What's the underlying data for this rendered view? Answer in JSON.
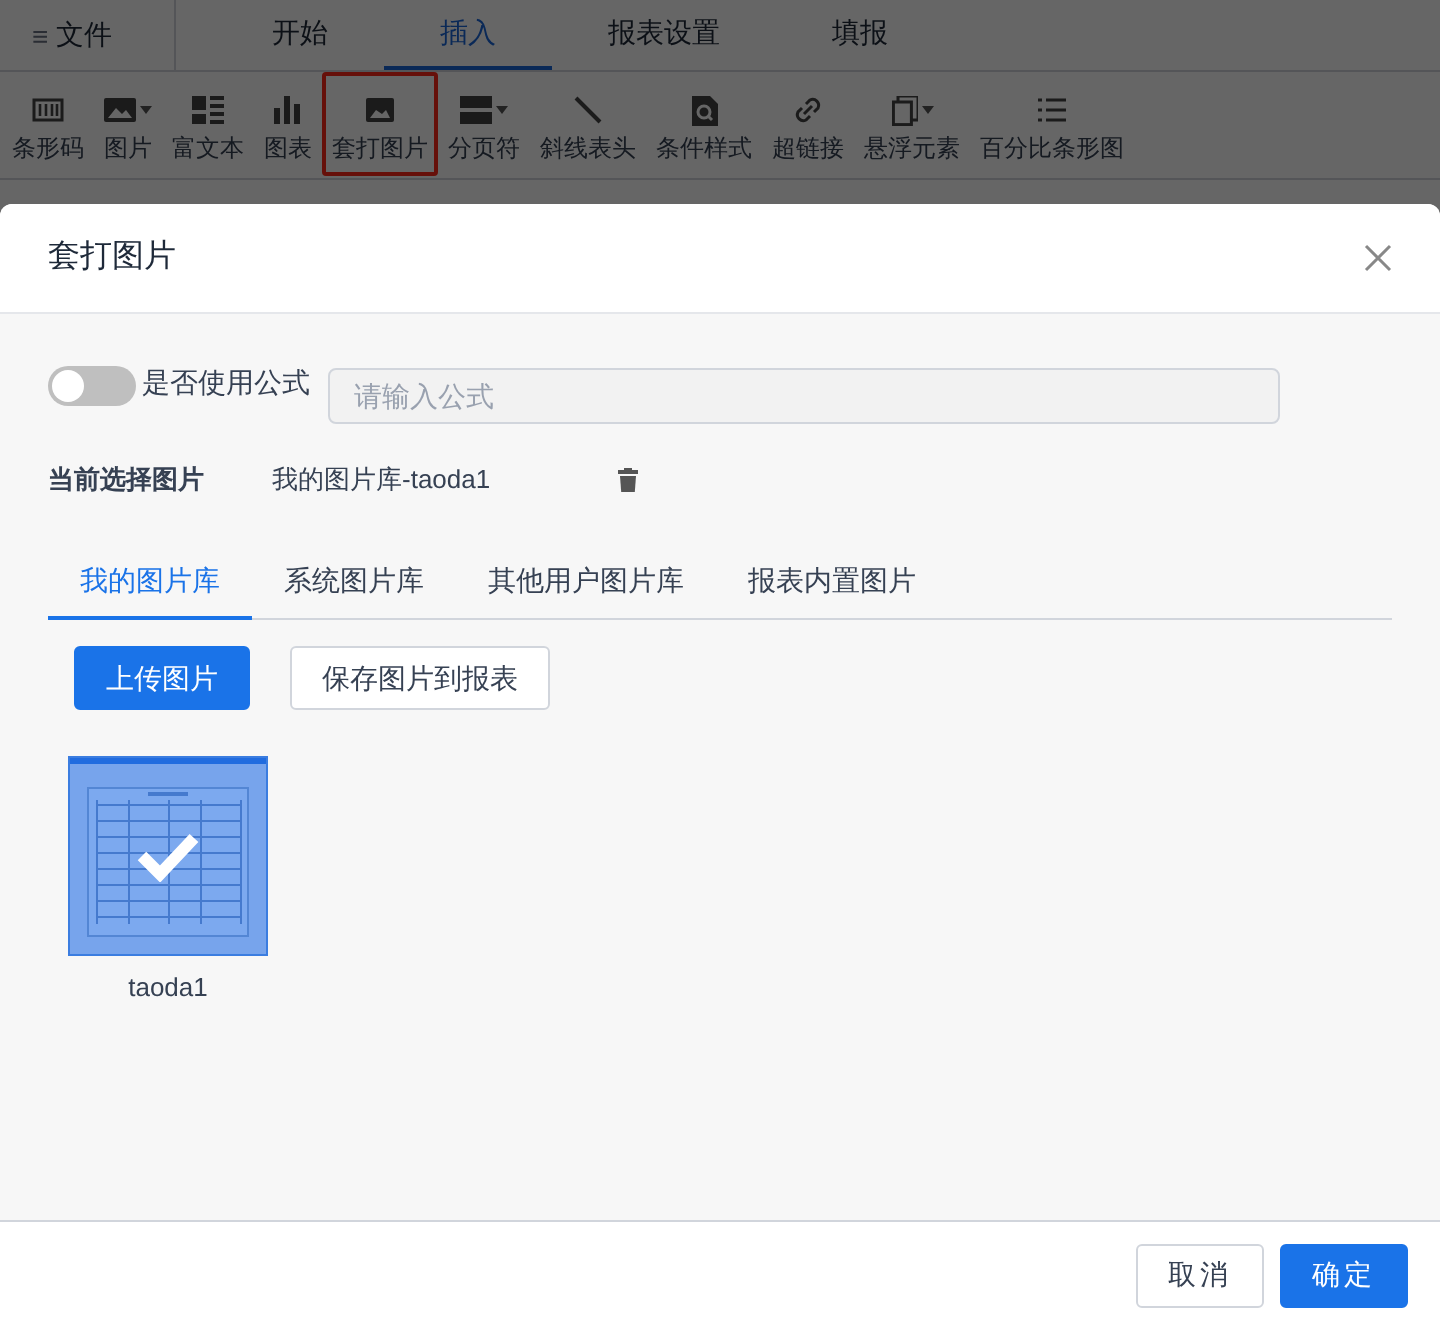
{
  "menu": {
    "icon_text": "≡",
    "label": "文件"
  },
  "tabs": [
    {
      "label": "开始",
      "selected": false
    },
    {
      "label": "插入",
      "selected": true
    },
    {
      "label": "报表设置",
      "selected": false
    },
    {
      "label": "填报",
      "selected": false
    }
  ],
  "toolbar": [
    {
      "label": "条形码",
      "dropdown": false,
      "highlighted": false
    },
    {
      "label": "图片",
      "dropdown": true,
      "highlighted": false
    },
    {
      "label": "富文本",
      "dropdown": false,
      "highlighted": false
    },
    {
      "label": "图表",
      "dropdown": false,
      "highlighted": false
    },
    {
      "label": "套打图片",
      "dropdown": false,
      "highlighted": true
    },
    {
      "label": "分页符",
      "dropdown": true,
      "highlighted": false
    },
    {
      "label": "斜线表头",
      "dropdown": false,
      "highlighted": false
    },
    {
      "label": "条件样式",
      "dropdown": false,
      "highlighted": false
    },
    {
      "label": "超链接",
      "dropdown": false,
      "highlighted": false
    },
    {
      "label": "悬浮元素",
      "dropdown": true,
      "highlighted": false
    },
    {
      "label": "百分比条形图",
      "dropdown": false,
      "highlighted": false
    }
  ],
  "dialog": {
    "title": "套打图片",
    "formula": {
      "on": false,
      "label": "是否使用公式",
      "placeholder": "请输入公式"
    },
    "current": {
      "label": "当前选择图片",
      "value": "我的图片库-taoda1"
    },
    "tabs": [
      {
        "label": "我的图片库",
        "selected": true
      },
      {
        "label": "系统图片库",
        "selected": false
      },
      {
        "label": "其他用户图片库",
        "selected": false
      },
      {
        "label": "报表内置图片",
        "selected": false
      }
    ],
    "buttons": [
      {
        "label": "上传图片",
        "kind": "primary"
      },
      {
        "label": "保存图片到报表",
        "kind": "default"
      }
    ],
    "images": [
      {
        "name": "taoda1",
        "selected": true,
        "kind": "picture"
      }
    ],
    "footer": [
      {
        "label": "取消",
        "kind": "default"
      },
      {
        "label": "确定",
        "kind": "primary"
      }
    ]
  }
}
